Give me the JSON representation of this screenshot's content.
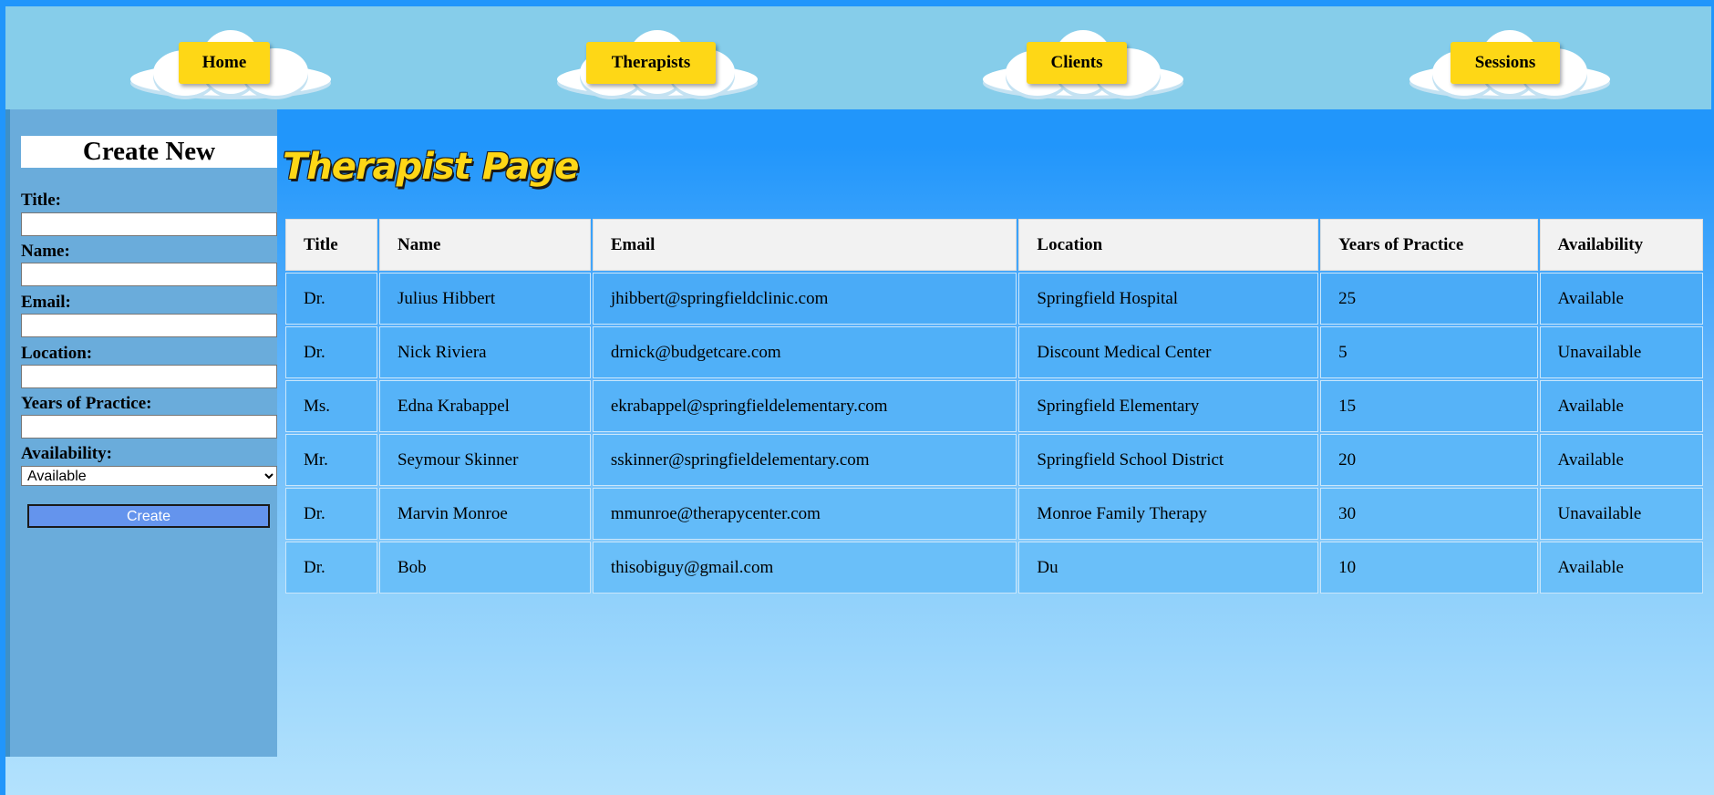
{
  "nav": {
    "items": [
      {
        "label": "Home"
      },
      {
        "label": "Therapists"
      },
      {
        "label": "Clients"
      },
      {
        "label": "Sessions"
      }
    ]
  },
  "sidebar": {
    "heading": "Create New",
    "fields": {
      "title": {
        "label": "Title:",
        "value": ""
      },
      "name": {
        "label": "Name:",
        "value": ""
      },
      "email": {
        "label": "Email:",
        "value": ""
      },
      "location": {
        "label": "Location:",
        "value": ""
      },
      "years": {
        "label": "Years of Practice:",
        "value": ""
      },
      "availability": {
        "label": "Availability:",
        "selected": "Available"
      }
    },
    "create_label": "Create"
  },
  "main": {
    "title": "Therapist Page",
    "columns": [
      "Title",
      "Name",
      "Email",
      "Location",
      "Years of Practice",
      "Availability"
    ],
    "rows": [
      [
        "Dr.",
        "Julius Hibbert",
        "jhibbert@springfieldclinic.com",
        "Springfield Hospital",
        "25",
        "Available"
      ],
      [
        "Dr.",
        "Nick Riviera",
        "drnick@budgetcare.com",
        "Discount Medical Center",
        "5",
        "Unavailable"
      ],
      [
        "Ms.",
        "Edna Krabappel",
        "ekrabappel@springfieldelementary.com",
        "Springfield Elementary",
        "15",
        "Available"
      ],
      [
        "Mr.",
        "Seymour Skinner",
        "sskinner@springfieldelementary.com",
        "Springfield School District",
        "20",
        "Available"
      ],
      [
        "Dr.",
        "Marvin Monroe",
        "mmunroe@therapycenter.com",
        "Monroe Family Therapy",
        "30",
        "Unavailable"
      ],
      [
        "Dr.",
        "Bob",
        "thisobiguy@gmail.com",
        "Du",
        "10",
        "Available"
      ]
    ]
  },
  "colors": {
    "accent_yellow": "#fed716",
    "nav_bg": "#86cdea",
    "sidebar_bg": "#6aacdb",
    "page_blue": "#2196fb",
    "create_button": "#6494ed"
  }
}
